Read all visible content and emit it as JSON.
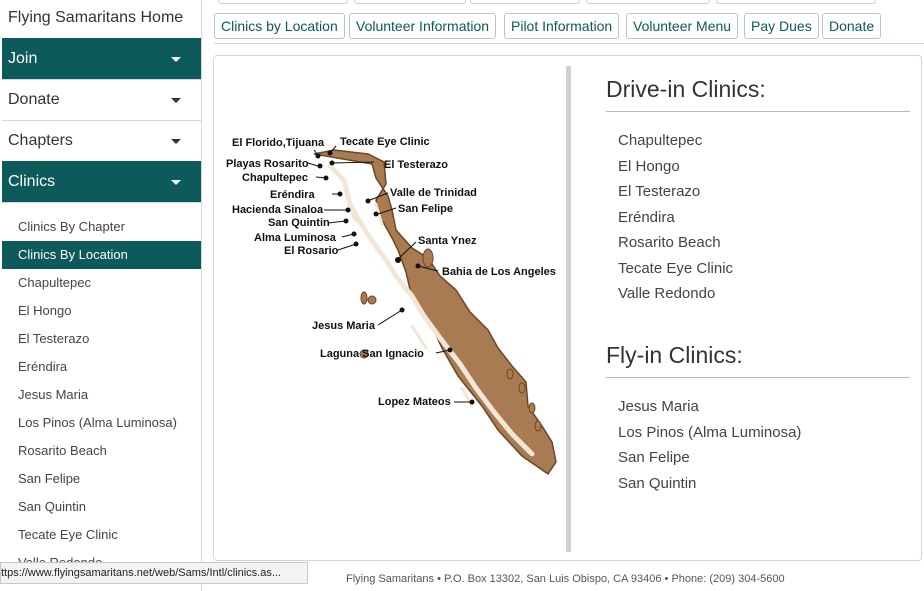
{
  "sidebar": {
    "home": "Flying Samaritans Home",
    "menus": [
      {
        "label": "Join"
      },
      {
        "label": "Donate"
      },
      {
        "label": "Chapters"
      },
      {
        "label": "Clinics"
      }
    ],
    "submenu": [
      "Clinics By Chapter",
      "Clinics By Location",
      "Chapultepec",
      "El Hongo",
      "El Testerazo",
      "Eréndira",
      "Jesus Maria",
      "Los Pinos (Alma Luminosa)",
      "Rosarito Beach",
      "San Felipe",
      "San Quintin",
      "Tecate Eye Clinic",
      "Valle Redondo"
    ]
  },
  "nav": {
    "buttons": [
      "Clinics by Location",
      "Volunteer Information",
      "Pilot Information",
      "Volunteer Menu",
      "Pay Dues",
      "Donate"
    ]
  },
  "map": {
    "labels": [
      "El Florido,Tijuana",
      "Tecate Eye Clinic",
      "Playas Rosarito",
      "El Testerazo",
      "Chapultepec",
      "Eréndira",
      "Valle de Trinidad",
      "Hacienda Sinaloa",
      "San Felipe",
      "San Quintin",
      "Alma Luminosa",
      "Santa Ynez",
      "El Rosario",
      "Bahia de Los Angeles",
      "Jesus Maria",
      "Laguna San Ignacio",
      "Lopez Mateos"
    ]
  },
  "drive_in": {
    "heading": "Drive-in Clinics:",
    "items": [
      "Chapultepec",
      "El Hongo",
      "El Testerazo",
      "Eréndira",
      "Rosarito Beach",
      "Tecate Eye Clinic",
      "Valle Redondo"
    ]
  },
  "fly_in": {
    "heading": "Fly-in Clinics:",
    "items": [
      "Jesus Maria",
      "Los Pinos (Alma Luminosa)",
      "San Felipe",
      "San Quintin"
    ]
  },
  "status_url": "ttps://www.flyingsamaritans.net/web/Sams/Intl/clinics.as...",
  "footer": "Flying Samaritans • P.O. Box 13302, San Luis Obispo, CA 93406 • Phone: (209) 304-5600",
  "colors": {
    "accent": "#0c5a5a",
    "land": "#a87b52",
    "land_dark": "#6e4522"
  }
}
